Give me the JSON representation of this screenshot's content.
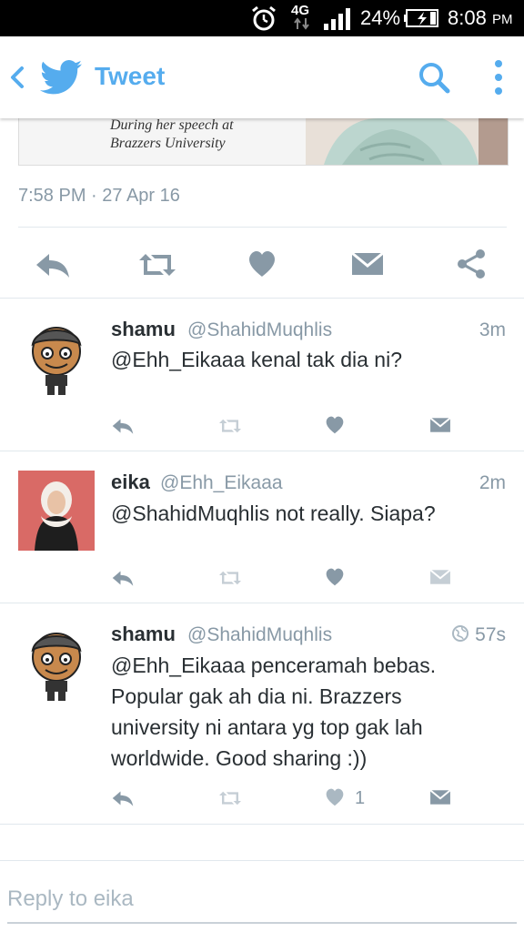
{
  "status_bar": {
    "network": "4G",
    "battery": "24%",
    "time": "8:08",
    "ampm": "PM"
  },
  "header": {
    "title": "Tweet"
  },
  "colors": {
    "brand_blue": "#55acee",
    "icon_gray": "#8899a6",
    "icon_light": "#aab8c2"
  },
  "main_tweet": {
    "media_caption_line1": "During her speech at",
    "media_caption_line2": "Brazzers University",
    "timestamp": "7:58 PM · 27 Apr 16"
  },
  "replies": [
    {
      "name": "shamu",
      "handle": "@ShahidMuqhlis",
      "time": "3m",
      "text": "@Ehh_Eikaaa kenal tak dia ni?"
    },
    {
      "name": "eika",
      "handle": "@Ehh_Eikaaa",
      "time": "2m",
      "text": "@ShahidMuqhlis not really. Siapa?"
    },
    {
      "name": "shamu",
      "handle": "@ShahidMuqhlis",
      "time": "57s",
      "text_lines": [
        "@Ehh_Eikaaa penceramah bebas.",
        "Popular gak ah dia ni. Brazzers",
        "university ni antara yg top gak lah",
        "worldwide. Good sharing :))"
      ],
      "like_count": "1"
    }
  ],
  "reply_input": {
    "placeholder": "Reply to eika"
  }
}
